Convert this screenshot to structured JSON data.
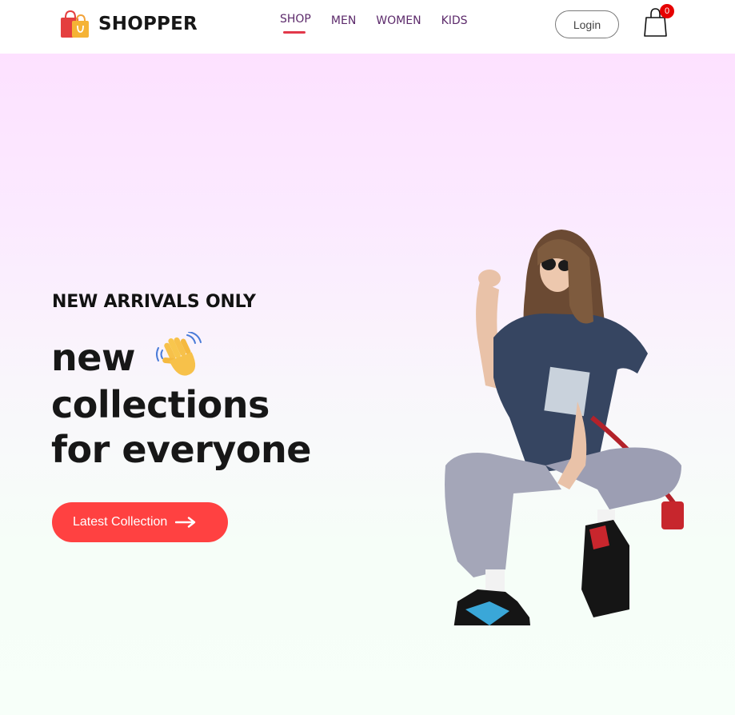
{
  "navbar": {
    "logo_text": "SHOPPER",
    "menu": [
      {
        "label": "SHOP",
        "active": true
      },
      {
        "label": "MEN",
        "active": false
      },
      {
        "label": "WOMEN",
        "active": false
      },
      {
        "label": "KIDS",
        "active": false
      }
    ],
    "login_label": "Login",
    "cart_count": "0"
  },
  "hero": {
    "tag": "NEW ARRIVALS ONLY",
    "line1": "new",
    "line2": "collections",
    "line3": "for everyone",
    "cta_label": "Latest Collection"
  },
  "colors": {
    "accent": "#ff4141",
    "nav_text": "#5c2a6b",
    "nav_underline": "#e2384a",
    "badge": "#e60000",
    "gradient_top": "#fde1ff",
    "gradient_bottom": "#f7fff9"
  },
  "icons": {
    "logo": "shopping-bags-icon",
    "cart": "shopping-bag-outline-icon",
    "wave": "waving-hand-emoji",
    "cta": "arrow-right-icon"
  }
}
